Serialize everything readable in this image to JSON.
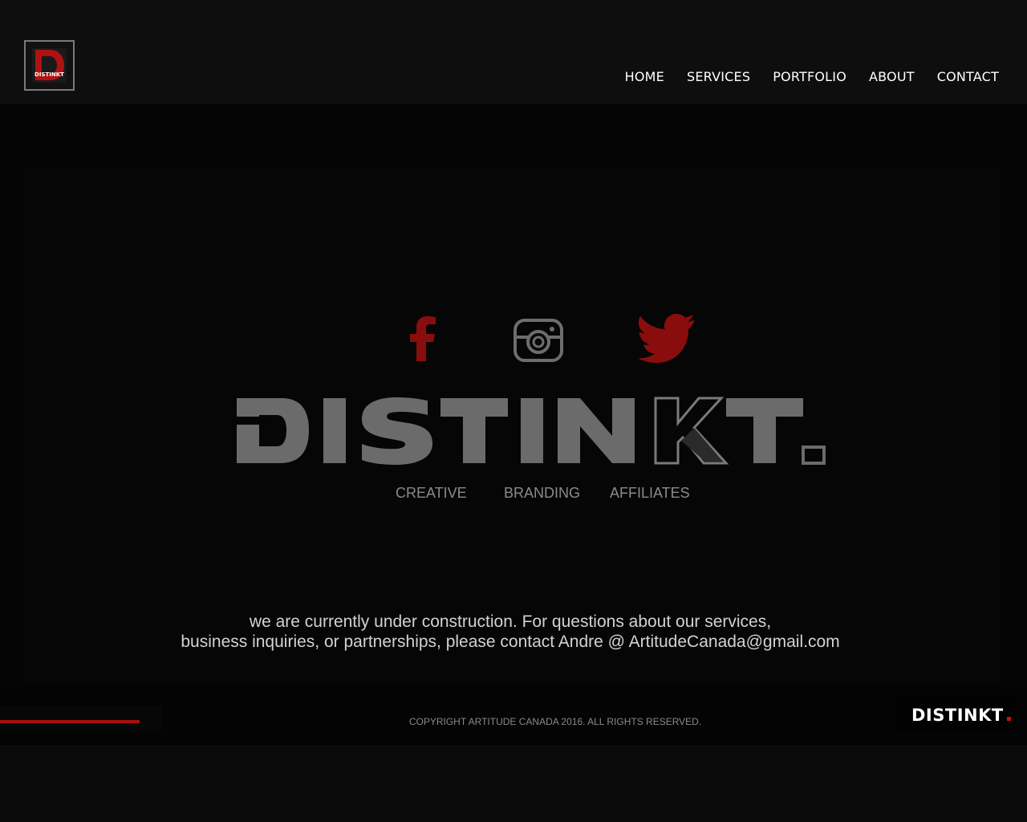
{
  "header": {
    "logo_text": "DISTINKT",
    "nav": [
      {
        "label": "HOME"
      },
      {
        "label": "SERVICES"
      },
      {
        "label": "PORTFOLIO"
      },
      {
        "label": "ABOUT"
      },
      {
        "label": "CONTACT"
      }
    ]
  },
  "hero": {
    "social_icons": [
      "facebook-icon",
      "instagram-icon",
      "twitter-icon"
    ],
    "wordmark": "DISTINKT.",
    "tagline": [
      "CREATIVE",
      "BRANDING",
      "AFFILIATES"
    ],
    "notice_line1": "we are currently under construction. For questions about our services,",
    "notice_line2": "business inquiries, or partnerships, please contact Andre @ ArtitudeCanada@gmail.com"
  },
  "footer": {
    "copyright": "COPYRIGHT ARTITUDE CANADA 2016. ALL RIGHTS RESERVED.",
    "logo_text": "DISTINKT.",
    "progress": 0.86
  },
  "colors": {
    "accent": "#a80f0f",
    "wordmark_gray": "#6b6b6b",
    "nav_text": "#ffffff"
  }
}
